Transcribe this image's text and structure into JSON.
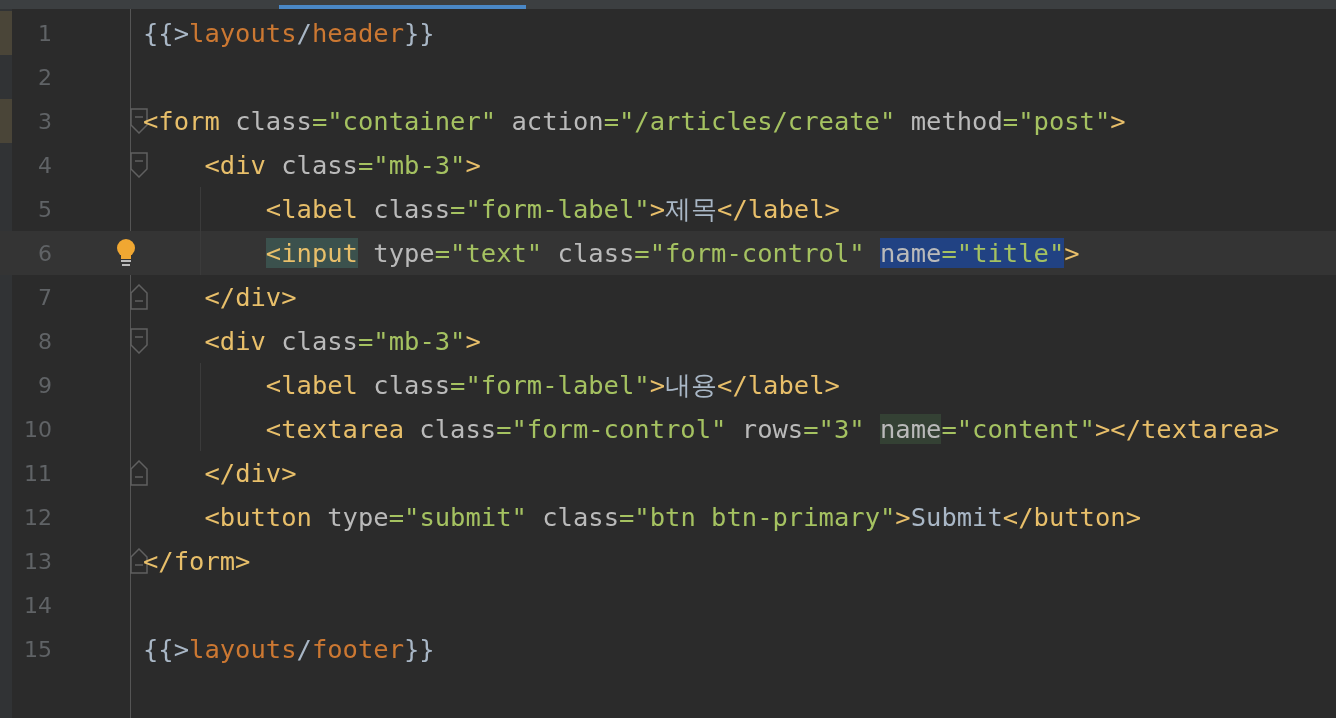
{
  "editor": {
    "lines": [
      {
        "number": "1",
        "kind": "plain",
        "current": false,
        "bulb": false,
        "guide": false,
        "changed": true,
        "tokens": [
          {
            "t": "{{>",
            "kind": "brace"
          },
          {
            "t": "layouts",
            "kind": "partial"
          },
          {
            "t": "/",
            "kind": "brace"
          },
          {
            "t": "header",
            "kind": "partial"
          },
          {
            "t": "}}",
            "kind": "brace"
          }
        ]
      },
      {
        "number": "2",
        "kind": "plain",
        "current": false,
        "bulb": false,
        "guide": false,
        "changed": false
      },
      {
        "number": "3",
        "kind": "opener",
        "current": false,
        "bulb": false,
        "guide": false,
        "changed": true,
        "tokens": [
          {
            "t": "<form",
            "kind": "tag"
          },
          {
            "t": " class",
            "kind": "attr"
          },
          {
            "t": "=",
            "kind": "eq"
          },
          {
            "t": "\"container\"",
            "kind": "string"
          },
          {
            "t": " action",
            "kind": "attr"
          },
          {
            "t": "=",
            "kind": "eq"
          },
          {
            "t": "\"/articles/create\"",
            "kind": "string"
          },
          {
            "t": " method",
            "kind": "attr"
          },
          {
            "t": "=",
            "kind": "eq"
          },
          {
            "t": "\"post\"",
            "kind": "string"
          },
          {
            "t": ">",
            "kind": "tag"
          }
        ]
      },
      {
        "number": "4",
        "kind": "opener",
        "current": false,
        "bulb": false,
        "guide": false,
        "changed": false,
        "tokens": [
          {
            "t": "    <div",
            "kind": "tag"
          },
          {
            "t": " class",
            "kind": "attr"
          },
          {
            "t": "=",
            "kind": "eq"
          },
          {
            "t": "\"mb-3\"",
            "kind": "string"
          },
          {
            "t": ">",
            "kind": "tag"
          }
        ]
      },
      {
        "number": "5",
        "kind": "plain",
        "current": false,
        "bulb": false,
        "guide": true,
        "changed": false,
        "tokens": [
          {
            "t": "        <label",
            "kind": "tag"
          },
          {
            "t": " class",
            "kind": "attr"
          },
          {
            "t": "=",
            "kind": "eq"
          },
          {
            "t": "\"form-label\"",
            "kind": "string"
          },
          {
            "t": ">",
            "kind": "tag"
          },
          {
            "t": "제목",
            "kind": "text"
          },
          {
            "t": "</label>",
            "kind": "tag"
          }
        ]
      },
      {
        "number": "6",
        "kind": "plain",
        "current": true,
        "bulb": true,
        "guide": true,
        "changed": false,
        "tokens": [
          {
            "t": "        <input",
            "kind": "tag",
            "color": "#3b514d"
          },
          {
            "t": " type",
            "kind": "attr"
          },
          {
            "t": "=",
            "kind": "eq"
          },
          {
            "t": "\"text\"",
            "kind": "string"
          },
          {
            "t": " class",
            "kind": "attr"
          },
          {
            "t": "=",
            "kind": "eq"
          },
          {
            "t": "\"form-control\"",
            "kind": "string"
          },
          {
            "t": " name",
            "kind": "attr",
            "color": "#214283"
          },
          {
            "t": "=",
            "kind": "eq",
            "color": "#214283"
          },
          {
            "t": "\"title\"",
            "kind": "string",
            "color": "#214283"
          },
          {
            "t": ">",
            "kind": "tag"
          }
        ]
      },
      {
        "number": "7",
        "kind": "closer",
        "current": false,
        "bulb": false,
        "guide": false,
        "changed": false,
        "tokens": [
          {
            "t": "    </div>",
            "kind": "tag"
          }
        ]
      },
      {
        "number": "8",
        "kind": "opener",
        "current": false,
        "bulb": false,
        "guide": false,
        "changed": false,
        "tokens": [
          {
            "t": "    <div",
            "kind": "tag"
          },
          {
            "t": " class",
            "kind": "attr"
          },
          {
            "t": "=",
            "kind": "eq"
          },
          {
            "t": "\"mb-3\"",
            "kind": "string"
          },
          {
            "t": ">",
            "kind": "tag"
          }
        ]
      },
      {
        "number": "9",
        "kind": "plain",
        "current": false,
        "bulb": false,
        "guide": true,
        "changed": false,
        "tokens": [
          {
            "t": "        <label",
            "kind": "tag"
          },
          {
            "t": " class",
            "kind": "attr"
          },
          {
            "t": "=",
            "kind": "eq"
          },
          {
            "t": "\"form-label\"",
            "kind": "string"
          },
          {
            "t": ">",
            "kind": "tag"
          },
          {
            "t": "내용",
            "kind": "text"
          },
          {
            "t": "</label>",
            "kind": "tag"
          }
        ]
      },
      {
        "number": "10",
        "kind": "plain",
        "current": false,
        "bulb": false,
        "guide": true,
        "changed": false,
        "tokens": [
          {
            "t": "        <textarea",
            "kind": "tag"
          },
          {
            "t": " class",
            "kind": "attr"
          },
          {
            "t": "=",
            "kind": "eq"
          },
          {
            "t": "\"form-control\"",
            "kind": "string"
          },
          {
            "t": " rows",
            "kind": "attr"
          },
          {
            "t": "=",
            "kind": "eq"
          },
          {
            "t": "\"3\"",
            "kind": "string"
          },
          {
            "t": " name",
            "kind": "attr",
            "color": "#344134"
          },
          {
            "t": "=",
            "kind": "eq"
          },
          {
            "t": "\"content\"",
            "kind": "string"
          },
          {
            "t": "></textarea>",
            "kind": "tag"
          }
        ]
      },
      {
        "number": "11",
        "kind": "closer",
        "current": false,
        "bulb": false,
        "guide": false,
        "changed": false,
        "tokens": [
          {
            "t": "    </div>",
            "kind": "tag"
          }
        ]
      },
      {
        "number": "12",
        "kind": "plain",
        "current": false,
        "bulb": false,
        "guide": false,
        "changed": false,
        "tokens": [
          {
            "t": "    <button",
            "kind": "tag"
          },
          {
            "t": " type",
            "kind": "attr"
          },
          {
            "t": "=",
            "kind": "eq"
          },
          {
            "t": "\"submit\"",
            "kind": "string"
          },
          {
            "t": " class",
            "kind": "attr"
          },
          {
            "t": "=",
            "kind": "eq"
          },
          {
            "t": "\"btn btn-primary\"",
            "kind": "string"
          },
          {
            "t": ">",
            "kind": "tag"
          },
          {
            "t": "Submit",
            "kind": "text"
          },
          {
            "t": "</button>",
            "kind": "tag"
          }
        ]
      },
      {
        "number": "13",
        "kind": "closer",
        "current": false,
        "bulb": false,
        "guide": false,
        "changed": false,
        "tokens": [
          {
            "t": "</form>",
            "kind": "tag"
          }
        ]
      },
      {
        "number": "14",
        "kind": "plain",
        "current": false,
        "bulb": false,
        "guide": false,
        "changed": false
      },
      {
        "number": "15",
        "kind": "plain",
        "current": false,
        "bulb": false,
        "guide": false,
        "changed": false,
        "tokens": [
          {
            "t": "{{>",
            "kind": "brace"
          },
          {
            "t": "layouts",
            "kind": "partial"
          },
          {
            "t": "/",
            "kind": "brace"
          },
          {
            "t": "footer",
            "kind": "partial"
          },
          {
            "t": "}}",
            "kind": "brace"
          }
        ]
      }
    ]
  }
}
